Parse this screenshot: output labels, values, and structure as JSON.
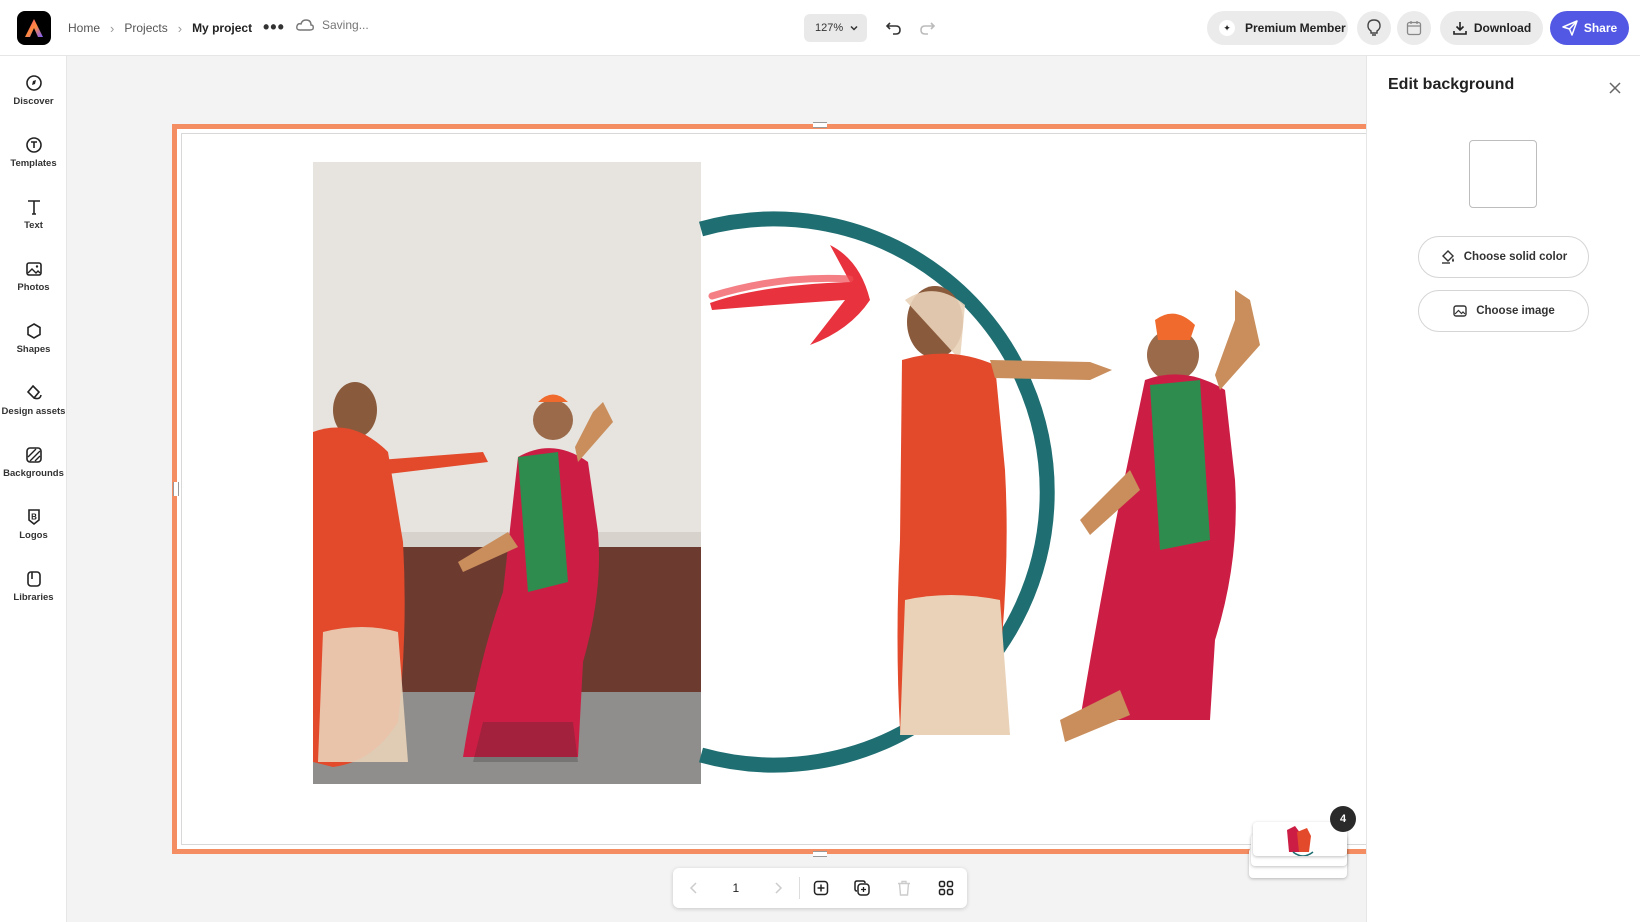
{
  "header": {
    "breadcrumbs": [
      "Home",
      "Projects",
      "My project"
    ],
    "status": "Saving...",
    "zoom": "127%",
    "premium_label": "Premium Member",
    "download_label": "Download",
    "share_label": "Share"
  },
  "sidebar": {
    "items": [
      {
        "label": "Discover",
        "icon": "discover-icon"
      },
      {
        "label": "Templates",
        "icon": "templates-icon"
      },
      {
        "label": "Text",
        "icon": "text-icon"
      },
      {
        "label": "Photos",
        "icon": "photos-icon"
      },
      {
        "label": "Shapes",
        "icon": "shapes-icon"
      },
      {
        "label": "Design assets",
        "icon": "design-assets-icon"
      },
      {
        "label": "Backgrounds",
        "icon": "backgrounds-icon"
      },
      {
        "label": "Logos",
        "icon": "logos-icon"
      },
      {
        "label": "Libraries",
        "icon": "libraries-icon"
      }
    ]
  },
  "pager": {
    "current_page": "1"
  },
  "pages_count": "4",
  "panel": {
    "title": "Edit background",
    "solid_color_label": "Choose solid color",
    "image_label": "Choose image"
  },
  "colors": {
    "accent": "#5258e4",
    "frame": "#f58d63",
    "ring": "#1f6e72",
    "arrow": "#e8323d"
  }
}
